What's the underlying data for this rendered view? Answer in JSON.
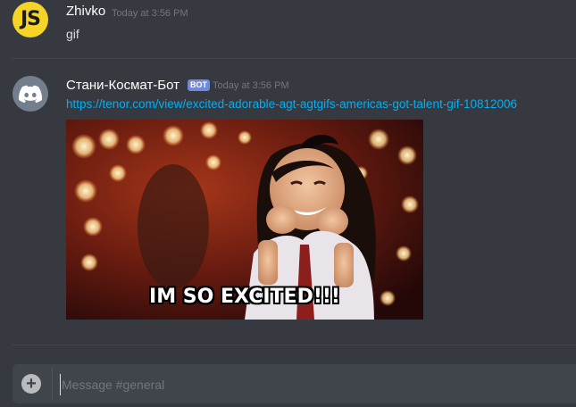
{
  "messages": [
    {
      "avatar": "JS",
      "username": "Zhivko",
      "timestamp": "Today at 3:56 PM",
      "text": "gif"
    },
    {
      "avatar_icon": "discord-logo-icon",
      "username": "Стани-Космат-Бот",
      "badge": "BOT",
      "timestamp": "Today at 3:56 PM",
      "link": "https://tenor.com/view/excited-adorable-agt-agtgifs-americas-got-talent-gif-10812006",
      "gif_caption": "IM SO EXCITED!!!"
    }
  ],
  "composer": {
    "placeholder": "Message #general",
    "attach_icon": "plus-circle-icon"
  },
  "colors": {
    "background": "#36393f",
    "link": "#00b0f4",
    "bot_badge": "#7289da",
    "avatar_js": "#f5d327"
  }
}
